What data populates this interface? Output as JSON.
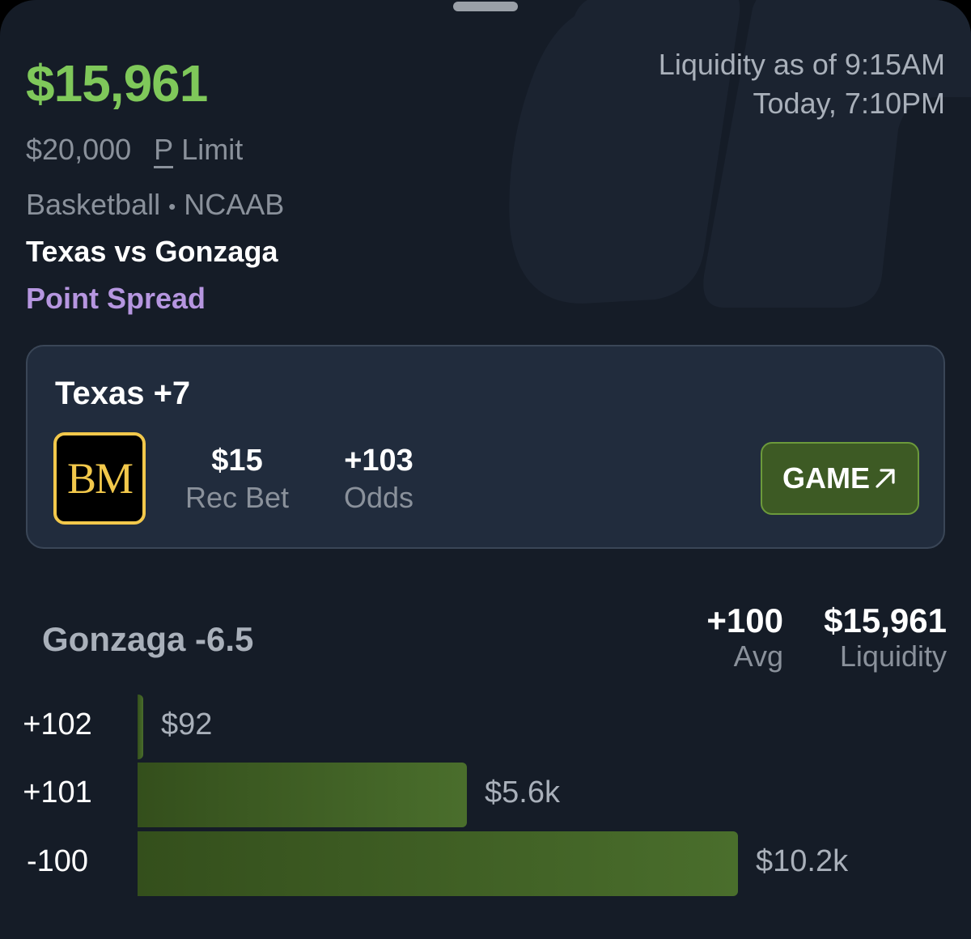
{
  "header": {
    "liquidity_amount": "$15,961",
    "liquidity_time": "Liquidity as of 9:15AM",
    "event_time": "Today, 7:10PM",
    "limit_amount": "$20,000",
    "limit_marker": "P",
    "limit_label": "Limit",
    "sport": "Basketball",
    "separator": "•",
    "league": "NCAAB",
    "matchup": "Texas vs Gonzaga",
    "market": "Point Spread"
  },
  "bet_card": {
    "title": "Texas +7",
    "book_logo_text": "BM",
    "book_logo_icon": "betmgm-logo",
    "rec_bet_value": "$15",
    "rec_bet_label": "Rec Bet",
    "odds_value": "+103",
    "odds_label": "Odds",
    "game_button_label": "GAME",
    "game_button_icon": "arrow-up-right-icon"
  },
  "opposing_side": {
    "title": "Gonzaga -6.5",
    "avg_value": "+100",
    "avg_label": "Avg",
    "liquidity_value": "$15,961",
    "liquidity_label": "Liquidity"
  },
  "ladder": {
    "max_amount": 10200,
    "rows": [
      {
        "odds": "+102",
        "amount_label": "$92",
        "amount": 92
      },
      {
        "odds": "+101",
        "amount_label": "$5.6k",
        "amount": 5600
      },
      {
        "odds": "-100",
        "amount_label": "$10.2k",
        "amount": 10200
      }
    ]
  },
  "colors": {
    "background": "#151c27",
    "card": "#212c3d",
    "accent_green": "#7fc85a",
    "market_purple": "#b696e0",
    "button_green": "#3d5a24",
    "bar_green": "#4a6e2c",
    "logo_gold": "#f2c84b"
  }
}
